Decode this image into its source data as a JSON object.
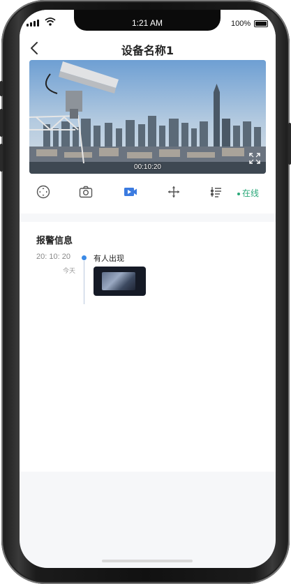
{
  "status_bar": {
    "time": "1:21 AM",
    "battery_text": "100%"
  },
  "header": {
    "title": "设备名称1",
    "back_icon": "chevron-left-icon"
  },
  "video": {
    "timestamp": "00:10:20",
    "fullscreen_icon": "fullscreen-icon"
  },
  "toolbar": {
    "icons": [
      "ptz-icon",
      "snapshot-camera-icon",
      "record-video-icon",
      "move-icon",
      "settings-sliders-icon"
    ],
    "active_color": "#3b7be0",
    "status_text": "在线",
    "status_color": "#2aa879"
  },
  "alarms": {
    "section_title": "报警信息",
    "items": [
      {
        "time": "20: 10: 20",
        "day": "今天",
        "title": "有人出现"
      }
    ],
    "dot_color": "#3b8ae6"
  }
}
